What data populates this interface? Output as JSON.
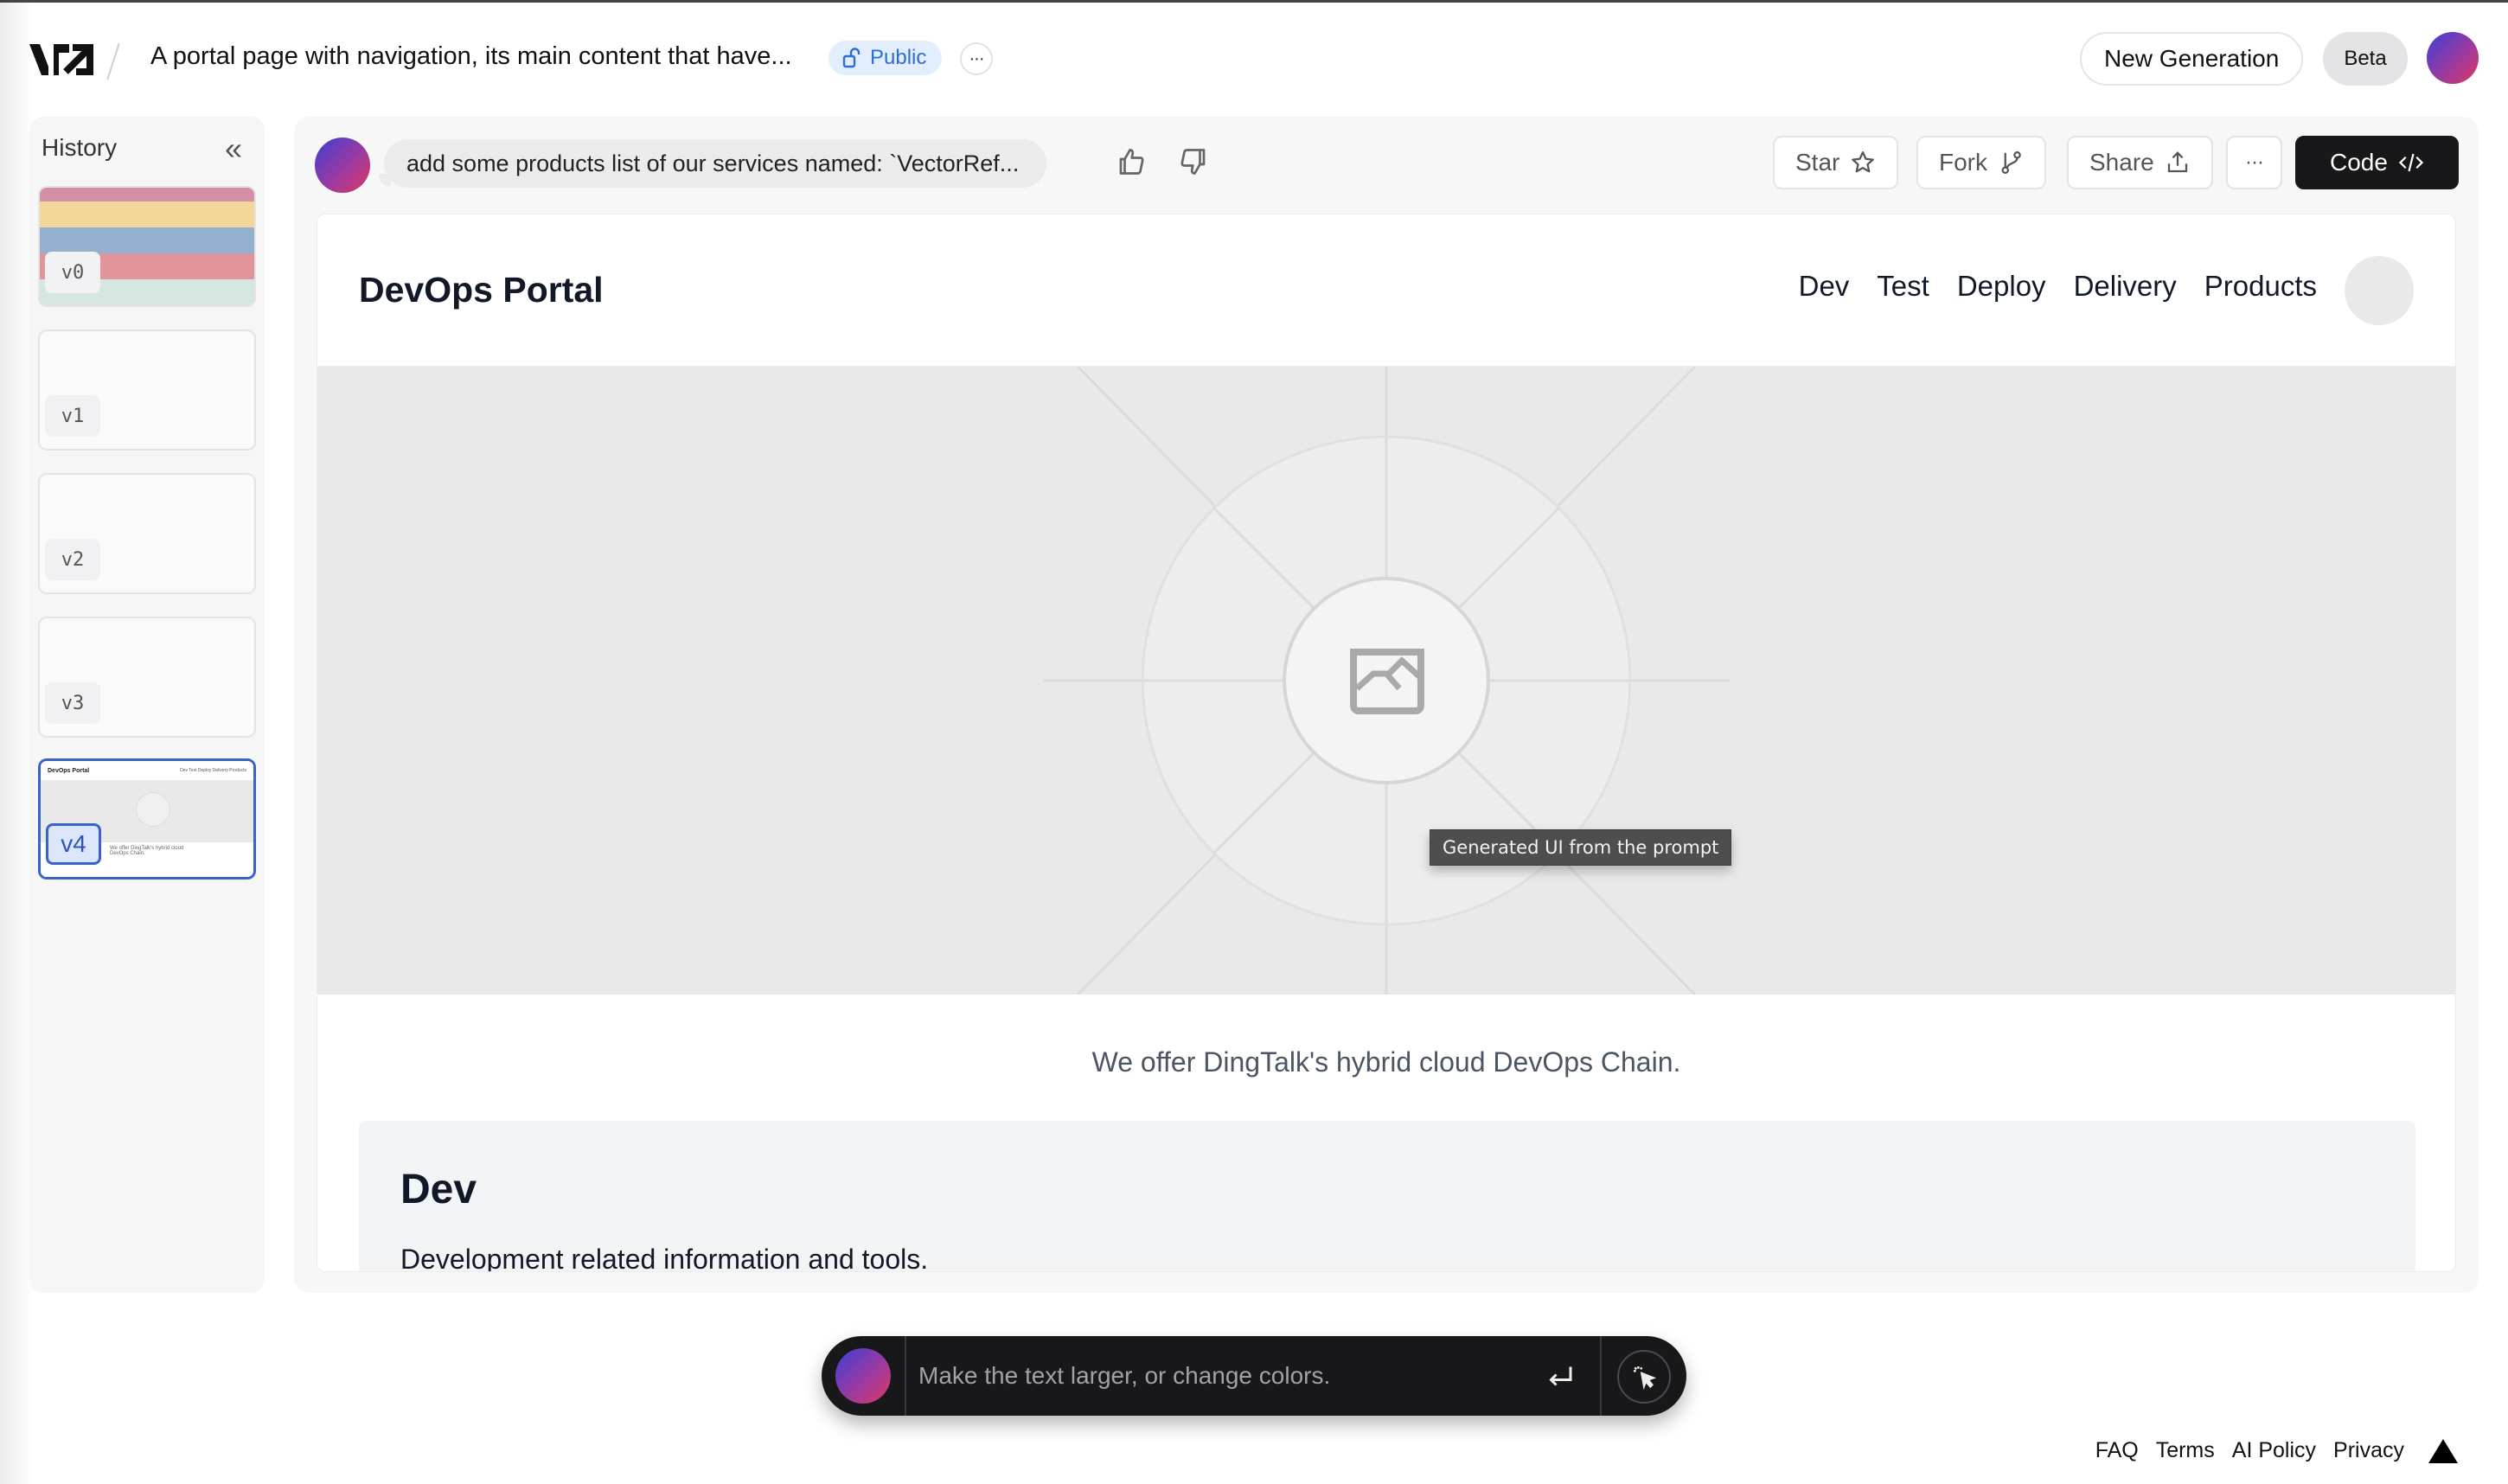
{
  "header": {
    "logo": "v0-logo",
    "project_title": "A portal page with navigation, its main content that have...",
    "visibility_label": "Public",
    "visibility_icon": "unlock-icon",
    "more_label": "···",
    "new_generation_label": "New Generation",
    "beta_label": "Beta"
  },
  "history": {
    "title": "History",
    "collapse_icon": "«",
    "versions": [
      {
        "label": "v0",
        "active": false
      },
      {
        "label": "v1",
        "active": false
      },
      {
        "label": "v2",
        "active": false
      },
      {
        "label": "v3",
        "active": false
      },
      {
        "label": "v4",
        "active": true
      }
    ],
    "thumb0_colors": [
      "#d48fa4",
      "#f3d79a",
      "#93b0cf",
      "#e0959b",
      "#d5e7e0"
    ],
    "thumb4_title": "DevOps Portal",
    "thumb4_nav": "Dev  Test  Deploy  Delivery  Products",
    "thumb4_tagline": "We offer DingTalk's hybrid cloud DevOps Chain."
  },
  "toolbar": {
    "prompt_text": "add some products list of our services named: `VectorRef...",
    "thumbs_up_icon": "thumbs-up-icon",
    "thumbs_down_icon": "thumbs-down-icon",
    "star_label": "Star",
    "fork_label": "Fork",
    "share_label": "Share",
    "more_label": "···",
    "code_label": "Code"
  },
  "preview": {
    "site_title": "DevOps Portal",
    "nav": [
      "Dev",
      "Test",
      "Deploy",
      "Delivery",
      "Products"
    ],
    "hero_tooltip": "Generated UI from the prompt",
    "tagline": "We offer DingTalk's hybrid cloud DevOps Chain.",
    "section": {
      "title": "Dev",
      "description": "Development related information and tools."
    }
  },
  "chat": {
    "placeholder": "Make the text larger, or change colors.",
    "value": ""
  },
  "footer": {
    "links": [
      "FAQ",
      "Terms",
      "AI Policy",
      "Privacy"
    ]
  }
}
